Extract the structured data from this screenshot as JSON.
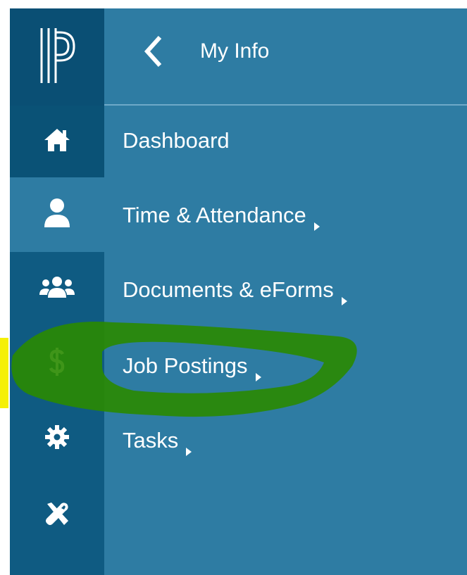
{
  "header": {
    "title": "My Info"
  },
  "menu": {
    "items": [
      {
        "label": "Dashboard",
        "has_submenu": false
      },
      {
        "label": "Time & Attendance",
        "has_submenu": true
      },
      {
        "label": "Documents & eForms",
        "has_submenu": true
      },
      {
        "label": "Job Postings",
        "has_submenu": true
      },
      {
        "label": "Tasks",
        "has_submenu": true
      }
    ]
  },
  "rail": {
    "icons": [
      "powerschool-logo-icon",
      "home-icon",
      "user-icon",
      "users-icon",
      "dollar-icon",
      "gear-icon",
      "tools-icon"
    ]
  },
  "colors": {
    "panel": "#2e7ca3",
    "rail": "#0f5b82",
    "rail_dark": "#0a4f74",
    "text": "#ffffff",
    "annotation_green": "#2a8a00",
    "annotation_yellow": "#f5f006"
  }
}
